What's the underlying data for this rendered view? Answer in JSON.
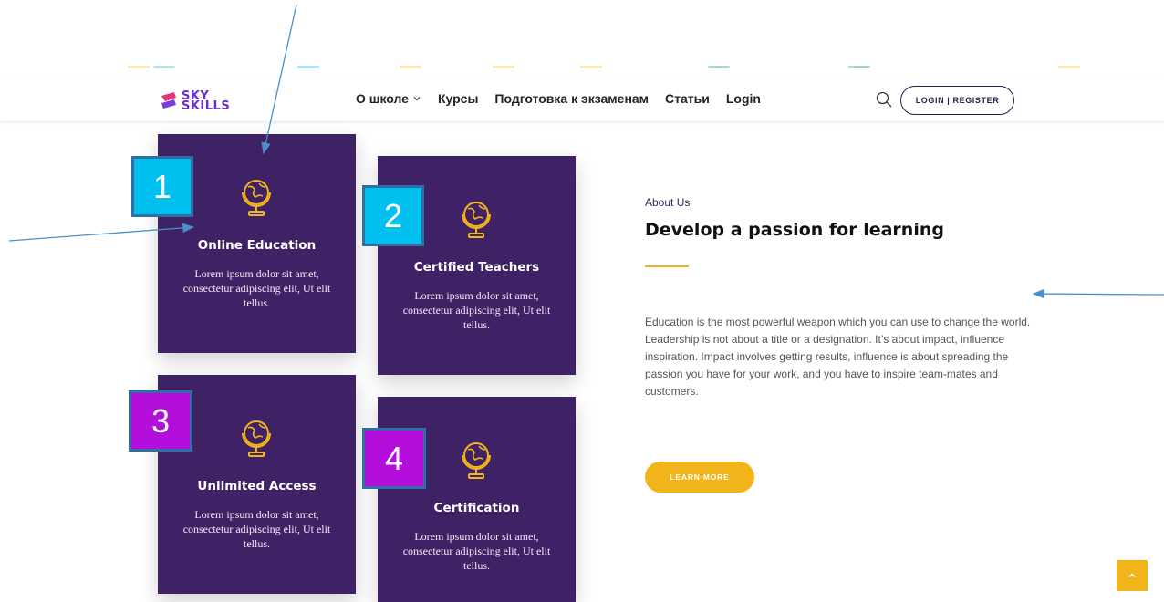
{
  "colors": {
    "primary_purple": "#3f2266",
    "accent_yellow": "#f2b41b",
    "annotation_blue": "#00c0ef",
    "annotation_purple": "#b40edc",
    "arrow_blue": "#4a90c8"
  },
  "header": {
    "logo": {
      "line1": "SKY",
      "line2": "SKILLS"
    },
    "nav": [
      {
        "label": "О школе",
        "has_dropdown": true
      },
      {
        "label": "Курсы"
      },
      {
        "label": "Подготовка к экзаменам"
      },
      {
        "label": "Статьи"
      },
      {
        "label": "Login"
      }
    ],
    "search_icon": "search-icon",
    "login_register_label": "LOGIN | REGISTER"
  },
  "features": [
    {
      "title": "Online Education",
      "desc": "Lorem ipsum dolor sit amet, consectetur adipiscing elit, Ut elit tellus.",
      "icon": "globe-icon"
    },
    {
      "title": "Certified Teachers",
      "desc": "Lorem ipsum dolor sit amet, consectetur adipiscing elit, Ut elit tellus.",
      "icon": "globe-icon"
    },
    {
      "title": "Unlimited Access",
      "desc": "Lorem ipsum dolor sit amet, consectetur adipiscing elit, Ut elit tellus.",
      "icon": "globe-icon"
    },
    {
      "title": "Certification",
      "desc": "Lorem ipsum dolor sit amet, consectetur adipiscing elit, Ut elit tellus.",
      "icon": "globe-icon"
    }
  ],
  "badges": [
    "1",
    "2",
    "3",
    "4"
  ],
  "about": {
    "kicker": "About Us",
    "title": "Develop a passion for learning",
    "text": "Education is the most powerful weapon which you can use to change the world. Leadership is not about a title or a designation. It’s about impact, influence inspiration. Impact involves getting results, influence is about spreading the passion you have for your work, and you have to inspire team-mates and customers.",
    "button_label": "LEARN MORE"
  },
  "scroll_top_icon": "chevron-up-icon"
}
